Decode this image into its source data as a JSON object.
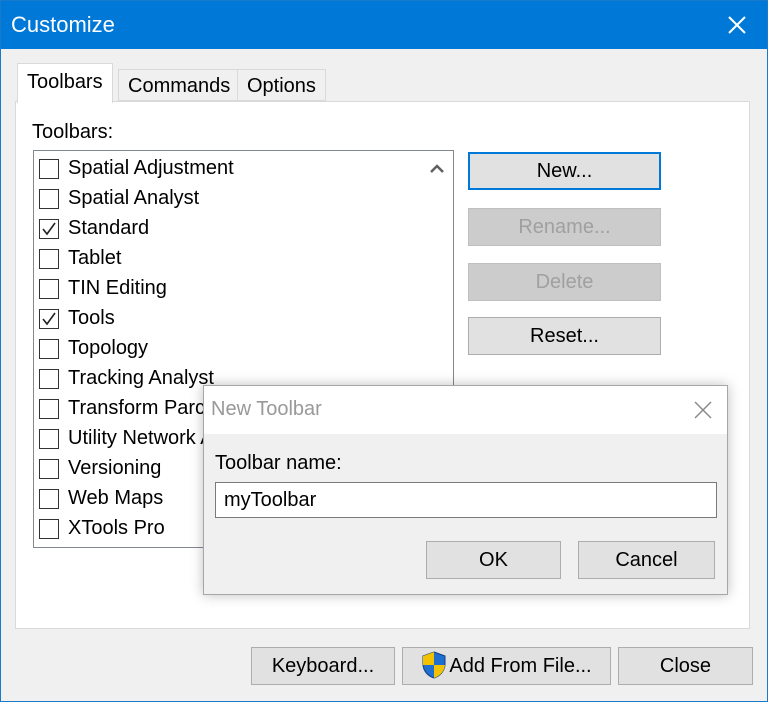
{
  "window": {
    "title": "Customize"
  },
  "tabs": [
    {
      "label": "Toolbars",
      "active": true
    },
    {
      "label": "Commands",
      "active": false
    },
    {
      "label": "Options",
      "active": false
    }
  ],
  "toolbars_panel": {
    "list_label": "Toolbars:",
    "items": [
      {
        "label": "Spatial Adjustment",
        "checked": false
      },
      {
        "label": "Spatial Analyst",
        "checked": false
      },
      {
        "label": "Standard",
        "checked": true
      },
      {
        "label": "Tablet",
        "checked": false
      },
      {
        "label": "TIN Editing",
        "checked": false
      },
      {
        "label": "Tools",
        "checked": true
      },
      {
        "label": "Topology",
        "checked": false
      },
      {
        "label": "Tracking Analyst",
        "checked": false
      },
      {
        "label": "Transform Parcels",
        "checked": false
      },
      {
        "label": "Utility Network Analyst",
        "checked": false
      },
      {
        "label": "Versioning",
        "checked": false
      },
      {
        "label": "Web Maps",
        "checked": false
      },
      {
        "label": "XTools Pro",
        "checked": false
      }
    ],
    "buttons": {
      "new": "New...",
      "rename": "Rename...",
      "delete": "Delete",
      "reset": "Reset..."
    }
  },
  "footer": {
    "keyboard": "Keyboard...",
    "add_from_file": "Add From File...",
    "close": "Close"
  },
  "new_toolbar_dialog": {
    "title": "New Toolbar",
    "name_label": "Toolbar name:",
    "name_value": "myToolbar",
    "ok": "OK",
    "cancel": "Cancel"
  },
  "colors": {
    "title_bar": "#0078d7",
    "default_button_border": "#0078d7",
    "shield_blue": "#1f6fd1",
    "shield_yellow": "#f2c200"
  },
  "icons": [
    "close-icon",
    "checkmark-icon",
    "scroll-up-arrow-icon",
    "uac-shield-icon"
  ]
}
